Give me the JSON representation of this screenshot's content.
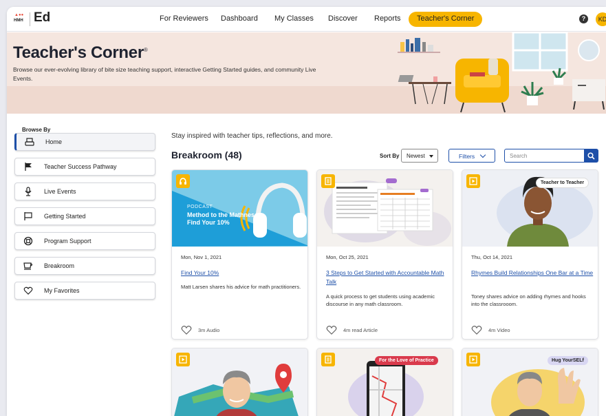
{
  "nav": {
    "logo_text": "HMH",
    "brand": "Ed",
    "links": [
      "For Reviewers",
      "Dashboard",
      "My Classes",
      "Discover",
      "Reports",
      "Teacher's Corner"
    ],
    "help": "?",
    "avatar": "KD"
  },
  "hero": {
    "title": "Teacher's Corner",
    "title_mark": "®",
    "subtitle": "Browse our ever-evolving library of bite size teaching support, interactive Getting Started guides, and community Live Events."
  },
  "sidebar": {
    "heading": "Browse By",
    "items": [
      {
        "label": "Home",
        "icon": "home-icon"
      },
      {
        "label": "Teacher Success Pathway",
        "icon": "flag-icon"
      },
      {
        "label": "Live Events",
        "icon": "microphone-icon"
      },
      {
        "label": "Getting Started",
        "icon": "flag-outline-icon"
      },
      {
        "label": "Program Support",
        "icon": "life-ring-icon"
      },
      {
        "label": "Breakroom",
        "icon": "coffee-cup-icon"
      },
      {
        "label": "My Favorites",
        "icon": "heart-icon"
      }
    ]
  },
  "main": {
    "tagline": "Stay inspired with teacher tips, reflections, and more.",
    "section_title": "Breakroom (48)",
    "sort_label": "Sort By",
    "sort_value": "Newest",
    "filters_label": "Filters",
    "search_placeholder": "Search"
  },
  "cards": [
    {
      "date": "Mon, Nov 1, 2021",
      "title": "Find Your 10%",
      "desc": "Matt Larsen shares his advice for math practitioners.",
      "meta": "3m Audio",
      "type": "audio",
      "podcast_kicker": "PODCAST",
      "podcast_title": "Method to the Mathness: Find Your 10%"
    },
    {
      "date": "Mon, Oct 25, 2021",
      "title": "3 Steps to Get Started with Accountable Math Talk",
      "desc": "A quick process to get students using academic discourse in any math classroom.",
      "meta": "4m read Article",
      "type": "article"
    },
    {
      "date": "Thu, Oct 14, 2021",
      "title": "Rhymes Build Relationships One Bar at a Time",
      "desc": "Toney shares advice on adding rhymes and hooks into the classrooom.",
      "meta": "4m Video",
      "type": "video",
      "tag": "Teacher to Teacher"
    },
    {
      "type": "video"
    },
    {
      "type": "article",
      "tag": "For the Love of Practice"
    },
    {
      "type": "video",
      "tag": "Hug YourSELf"
    }
  ],
  "colors": {
    "accent": "#1d4fa8",
    "yellow": "#f7b500",
    "hero_bg": "#f5e6df",
    "podcast_blue": "#1e9ed8"
  }
}
